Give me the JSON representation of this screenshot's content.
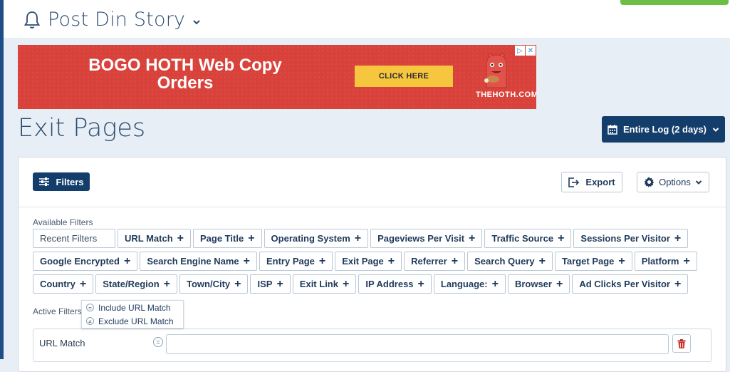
{
  "site": {
    "title": "Post Din Story"
  },
  "ad": {
    "headline": "BOGO HOTH Web Copy Orders",
    "cta": "CLICK HERE",
    "brand": "THEHOTH.COM"
  },
  "page": {
    "title": "Exit Pages"
  },
  "date_range": {
    "label": "Entire Log (2 days)"
  },
  "toolbar": {
    "filters_label": "Filters",
    "export_label": "Export",
    "options_label": "Options"
  },
  "available_filters": {
    "label": "Available Filters",
    "recent_label": "Recent Filters",
    "rows": [
      [
        "URL Match",
        "Page Title",
        "Operating System",
        "Pageviews Per Visit",
        "Traffic Source",
        "Sessions Per Visitor"
      ],
      [
        "Google Encrypted",
        "Search Engine Name",
        "Entry Page",
        "Exit Page",
        "Referrer",
        "Search Query",
        "Target Page",
        "Platform"
      ],
      [
        "Country",
        "State/Region",
        "Town/City",
        "ISP",
        "Exit Link",
        "IP Address",
        "Language:",
        "Browser",
        "Ad Clicks Per Visitor"
      ]
    ]
  },
  "active_filters": {
    "label": "Active Filters",
    "match_options": [
      "Include URL Match",
      "Exclude URL Match"
    ],
    "rows": [
      {
        "name": "URL Match",
        "value": ""
      }
    ]
  },
  "colors": {
    "primary": "#133d6b",
    "accent_green": "#6cbf44",
    "ad_red": "#d8423b",
    "ad_yellow": "#f7c63f",
    "delete_red": "#c62828"
  }
}
